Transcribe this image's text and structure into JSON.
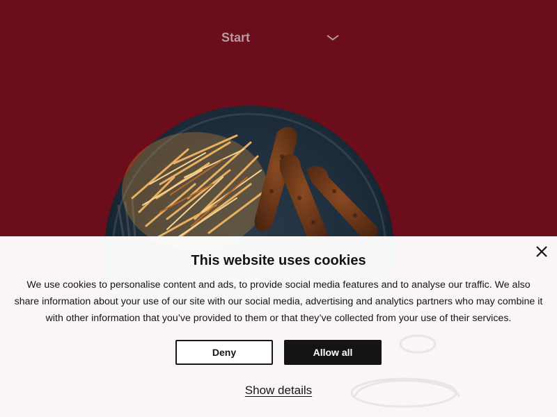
{
  "header": {
    "nav_label": "Start",
    "nav_icon": "chevron-down-icon"
  },
  "hero": {
    "image": "plate-of-hash-browns-and-sausages"
  },
  "cookie_banner": {
    "title": "This website uses cookies",
    "body": "We use cookies to personalise content and ads, to provide social media features and to analyse our traffic. We also share information about your use of our site with our social media, advertising and analytics partners who may combine it with other information that you’ve provided to them or that they’ve collected from your use of their services.",
    "deny_label": "Deny",
    "allow_label": "Allow all",
    "details_label": "Show details",
    "close_icon": "close-icon"
  },
  "colors": {
    "background": "#6b0d1a",
    "nav_text": "#b99aa1",
    "banner_bg": "#ffffff",
    "button_dark": "#141414"
  }
}
